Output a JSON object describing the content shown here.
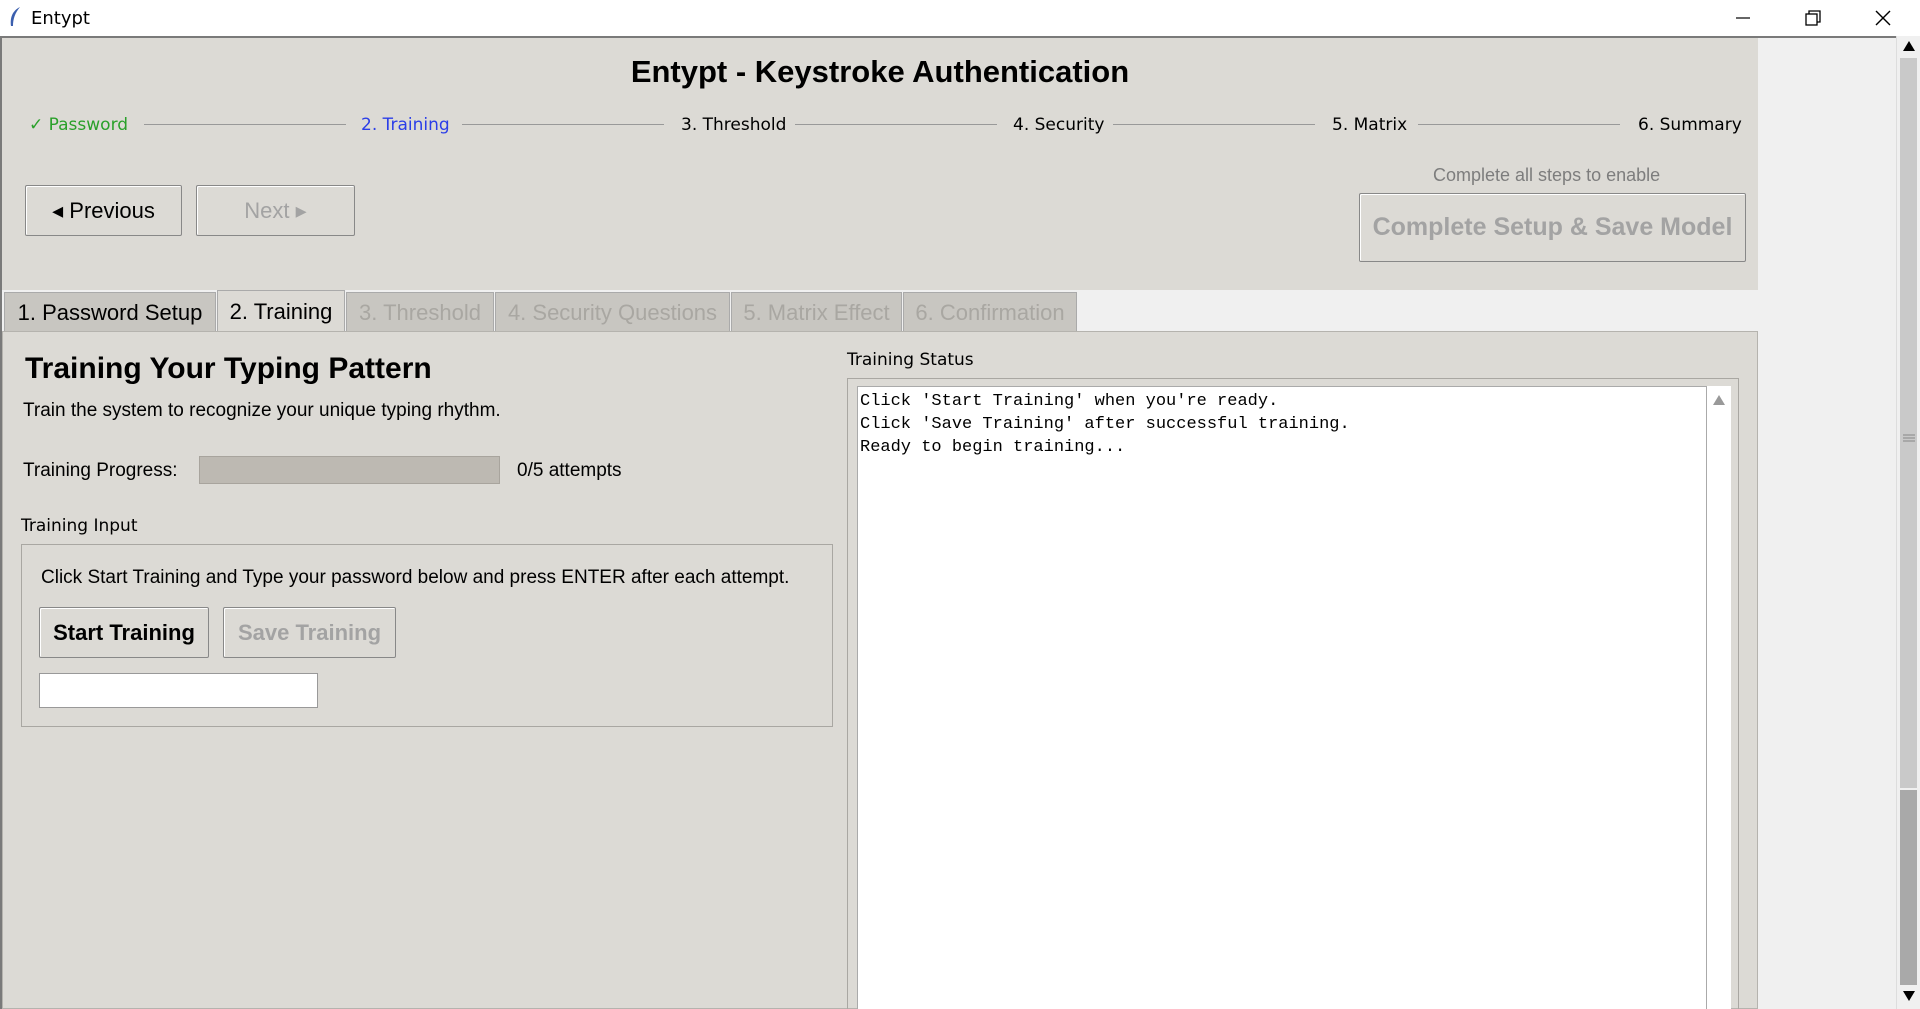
{
  "window": {
    "title": "Entypt",
    "controls": [
      "minimize-icon",
      "restore-icon",
      "close-icon"
    ]
  },
  "header": {
    "title": "Entypt - Keystroke Authentication",
    "steps": [
      {
        "label": "✓ Password",
        "state": "done",
        "color": "#2aa02a"
      },
      {
        "label": "2. Training",
        "state": "current",
        "color": "#2b3ee8"
      },
      {
        "label": "3. Threshold",
        "state": "pending"
      },
      {
        "label": "4. Security",
        "state": "pending"
      },
      {
        "label": "5. Matrix",
        "state": "pending"
      },
      {
        "label": "6. Summary",
        "state": "pending"
      }
    ],
    "previous_label": "◂ Previous",
    "next_label": "Next ▸",
    "hint": "Complete all steps to enable",
    "complete_label": "Complete Setup & Save Model"
  },
  "tabs": [
    {
      "label": "1. Password Setup",
      "state": "enabled"
    },
    {
      "label": "2. Training",
      "state": "active"
    },
    {
      "label": "3. Threshold",
      "state": "disabled"
    },
    {
      "label": "4. Security Questions",
      "state": "disabled"
    },
    {
      "label": "5. Matrix Effect",
      "state": "disabled"
    },
    {
      "label": "6. Confirmation",
      "state": "disabled"
    }
  ],
  "training": {
    "heading": "Training Your Typing Pattern",
    "description": "Train the system to recognize your unique typing rhythm.",
    "progress_label": "Training Progress:",
    "progress_fraction": 0,
    "attempts_text": "0/5 attempts",
    "input_group_label": "Training Input",
    "instruction": "Click Start Training and Type your password below and press ENTER after each attempt.",
    "start_label": "Start Training",
    "save_label": "Save Training",
    "entry_value": ""
  },
  "status": {
    "group_label": "Training Status",
    "log": "Click 'Start Training' when you're ready.\nClick 'Save Training' after successful training.\nReady to begin training..."
  },
  "colors": {
    "panel": "#dcdad5",
    "done_step": "#2aa02a",
    "current_step": "#2b3ee8",
    "disabled_text": "#a3a3a3"
  }
}
